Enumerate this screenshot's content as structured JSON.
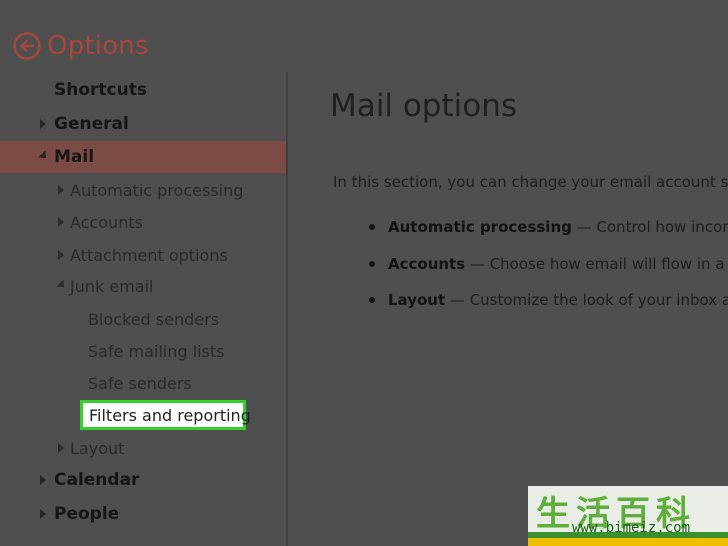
{
  "header": {
    "title": "Options"
  },
  "sidebar": {
    "items": [
      {
        "label": "Shortcuts"
      },
      {
        "label": "General"
      },
      {
        "label": "Mail"
      },
      {
        "label": "Automatic processing"
      },
      {
        "label": "Accounts"
      },
      {
        "label": "Attachment options"
      },
      {
        "label": "Junk email"
      },
      {
        "label": "Blocked senders"
      },
      {
        "label": "Safe mailing lists"
      },
      {
        "label": "Safe senders"
      },
      {
        "label": "Filters and reporting"
      },
      {
        "label": "Layout"
      },
      {
        "label": "Calendar"
      },
      {
        "label": "People"
      }
    ]
  },
  "content": {
    "title": "Mail options",
    "intro": "In this section, you can change your email account s",
    "bullets": [
      {
        "term": "Automatic processing",
        "text": " — Control how incom"
      },
      {
        "term": "Accounts",
        "text": " — Choose how email will flow in a"
      },
      {
        "term": "Layout",
        "text": " — Customize the look of your inbox a"
      }
    ]
  },
  "watermark": {
    "cn": "生活百科",
    "url": "www.bimeiz.com"
  },
  "colors": {
    "accent": "#a8463c",
    "active_row": "#7c4b45",
    "highlight_border": "#35d12e"
  }
}
